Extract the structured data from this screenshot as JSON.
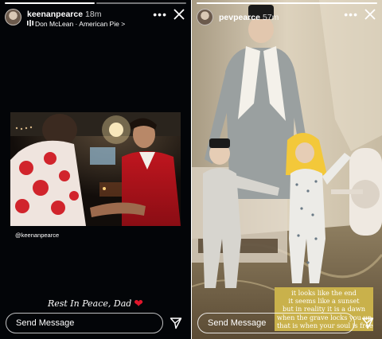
{
  "left_story": {
    "username": "keenanpearce",
    "timestamp": "18m",
    "music": "Don McLean · American Pie >",
    "mention": "@keenanpearce",
    "caption": "Rest In Peace, Dad",
    "caption_heart": "❤",
    "message_placeholder": "Send Message",
    "progress_segments": 2,
    "progress_active": 1
  },
  "right_story": {
    "username": "pevpearce",
    "timestamp": "57m",
    "message_placeholder": "Send Message",
    "poem_lines": [
      "it looks like the end",
      "it seems like a sunset",
      "but in reality it is a dawn",
      "when the grave locks you up",
      "that is when your soul is free"
    ],
    "progress_segments": 1
  },
  "icons": {
    "more": "more-dots-icon",
    "close": "close-icon",
    "send": "send-icon",
    "music": "music-note-icon",
    "heart": "heart-icon"
  },
  "colors": {
    "left_background": "#030508",
    "poem_background": "#c9b14b",
    "heart": "#e0162b"
  }
}
